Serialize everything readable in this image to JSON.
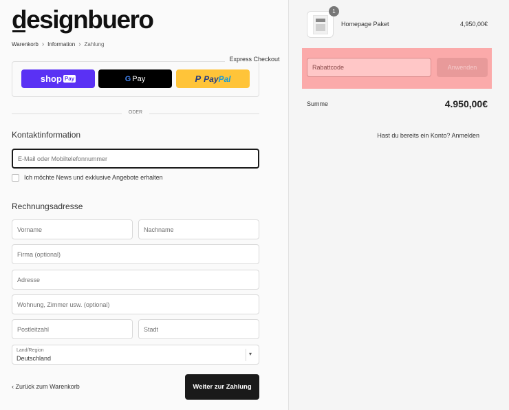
{
  "brand": {
    "logo_rest": "esignbuero",
    "logo_first": "d"
  },
  "breadcrumb": {
    "items": [
      "Warenkorb",
      "Information",
      "Zahlung"
    ]
  },
  "express": {
    "title": "Express Checkout",
    "shop_pay": {
      "label": "shop",
      "badge": "Pay"
    },
    "google_pay": {
      "g": "G",
      "label": "Pay"
    },
    "paypal": {
      "part1": "Pay",
      "part2": "Pal"
    }
  },
  "divider": "ODER",
  "contact": {
    "heading": "Kontaktinformation",
    "account_question": "Hast du bereits ein Konto?",
    "login_link": "Anmelden",
    "email_placeholder": "E-Mail oder Mobiltelefonnummer",
    "newsletter_label": "Ich möchte News und exklusive Angebote erhalten"
  },
  "billing": {
    "heading": "Rechnungsadresse",
    "first_name": "Vorname",
    "last_name": "Nachname",
    "company": "Firma (optional)",
    "address": "Adresse",
    "apartment": "Wohnung, Zimmer usw. (optional)",
    "zip": "Postleitzahl",
    "city": "Stadt",
    "country_label": "Land/Region",
    "country_value": "Deutschland"
  },
  "nav": {
    "back": "Zurück zum Warenkorb",
    "next": "Weiter zur Zahlung"
  },
  "cart": {
    "quantity": "1",
    "product_name": "Homepage Paket",
    "product_price": "4,950,00€",
    "discount_placeholder": "Rabattcode",
    "apply_label": "Anwenden",
    "sum_label": "Summe",
    "sum_value": "4.950,00€"
  },
  "colors": {
    "shop_pay": "#5a31f4",
    "paypal": "#ffc439",
    "dark": "#1a1a1a",
    "highlight": "#ff6c6c"
  }
}
